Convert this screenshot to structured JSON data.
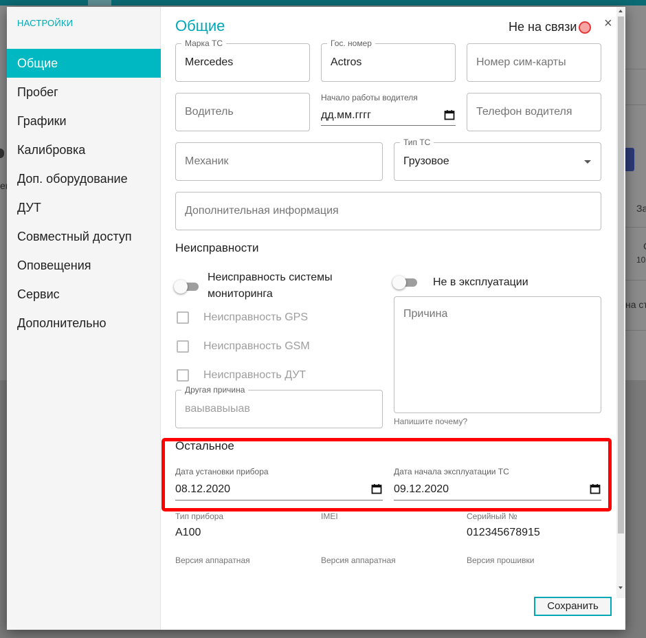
{
  "background": {
    "text_fragments": [
      "er",
      "За",
      "С",
      "10",
      "на ст"
    ]
  },
  "sidebar": {
    "title": "НАСТРОЙКИ",
    "items": [
      {
        "label": "Общие",
        "active": true
      },
      {
        "label": "Пробег"
      },
      {
        "label": "Графики"
      },
      {
        "label": "Калибровка"
      },
      {
        "label": "Доп. оборудование"
      },
      {
        "label": "ДУТ"
      },
      {
        "label": "Совместный доступ"
      },
      {
        "label": "Оповещения"
      },
      {
        "label": "Сервис"
      },
      {
        "label": "Дополнительно"
      }
    ]
  },
  "header": {
    "title": "Общие",
    "status": "Не на связи",
    "close": "×"
  },
  "form": {
    "brand": {
      "label": "Марка ТС",
      "value": "Mercedes"
    },
    "plate": {
      "label": "Гос. номер",
      "value": "Actros"
    },
    "sim": {
      "placeholder": "Номер сим-карты"
    },
    "driver": {
      "placeholder": "Водитель"
    },
    "driver_start": {
      "label": "Начало работы водителя",
      "value": "дд.мм.гггг"
    },
    "driver_phone": {
      "placeholder": "Телефон водителя"
    },
    "mechanic": {
      "placeholder": "Механик"
    },
    "vehicle_type": {
      "label": "Тип ТС",
      "value": "Грузовое"
    },
    "extra_info": {
      "placeholder": "Дополнительная информация"
    }
  },
  "faults": {
    "title": "Неисправности",
    "monitoring_toggle": {
      "label_line1": "Неисправность системы",
      "label_line2": "мониторинга",
      "on": false
    },
    "not_in_service_toggle": {
      "label": "Не в эксплуатации",
      "on": false
    },
    "checkboxes": [
      {
        "label": "Неисправность GPS",
        "checked": false
      },
      {
        "label": "Неисправность GSM",
        "checked": false
      },
      {
        "label": "Неисправность ДУТ",
        "checked": false
      }
    ],
    "other_reason": {
      "label": "Другая причина",
      "value": "ваывавыыав"
    },
    "reason": {
      "placeholder": "Причина",
      "helper": "Напишите почему?"
    }
  },
  "other": {
    "title": "Остальное",
    "install_date": {
      "label": "Дата установки прибора",
      "value": "08.12.2020"
    },
    "operation_start": {
      "label": "Дата начала эксплуатации ТС",
      "value": "09.12.2020"
    }
  },
  "device": {
    "type_label": "Тип прибора",
    "type_value": "A100",
    "imei_label": "IMEI",
    "imei_value": "",
    "serial_label": "Серийный №",
    "serial_value": "012345678915",
    "hw_version_label_1": "Версия аппаратная",
    "hw_version_label_2": "Версия аппаратная",
    "fw_version_label": "Версия прошивки"
  },
  "actions": {
    "save_label": "Сохранить"
  },
  "colors": {
    "accent": "#00b8c1",
    "title": "#00a8b5",
    "highlight": "#ff0000",
    "status_dot": "#f7a5a5"
  }
}
